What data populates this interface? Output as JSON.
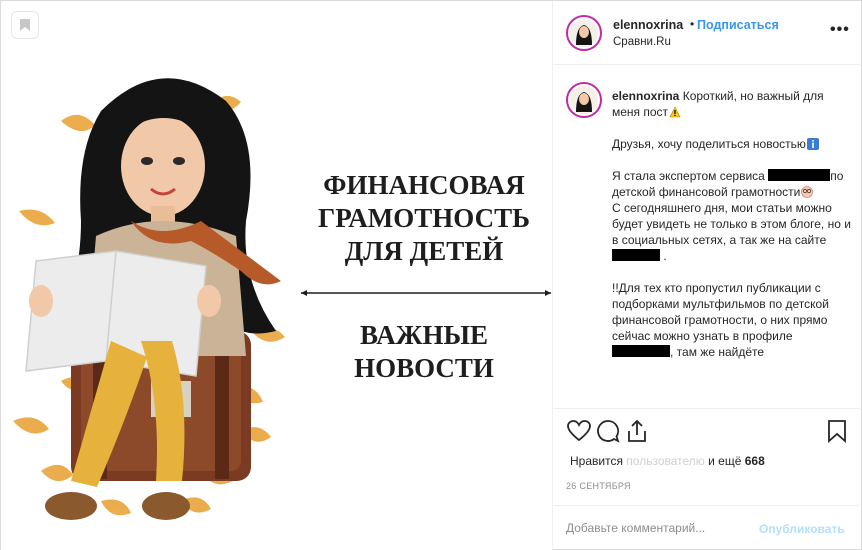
{
  "header": {
    "username": "elennoxrina",
    "separator": "•",
    "follow_label": "Подписаться",
    "location": "Сравни.Ru",
    "more_icon": "more-horizontal-icon"
  },
  "image": {
    "headline_1": [
      "ФИНАНСОВАЯ",
      "ГРАМОТНОСТЬ",
      "ДЛЯ ДЕТЕЙ"
    ],
    "headline_2": [
      "ВАЖНЫЕ",
      "НОВОСТИ"
    ],
    "bookmark_icon": "bookmark-filled-icon"
  },
  "caption": {
    "username": "elennoxrina",
    "p1": "Короткий, но важный для меня пост",
    "p2": "Друзья, хочу поделиться новостью",
    "p3a": "Я стала экспертом сервиса",
    "p3b": "по детской финансовой грамотности",
    "p3c": "С сегодняшнего дня, мои статьи можно будет увидеть не только в этом блоге, но и в социальных сетях, а так же на сайте",
    "p3d": ".",
    "p4a": "!!Для тех кто пропустил публикации с подборками мультфильмов по детской финансовой грамотности, о них прямо сейчас можно узнать в профиле",
    "p4b": ", там же найдёте"
  },
  "actions": {
    "like_icon": "heart-icon",
    "comment_icon": "comment-icon",
    "share_icon": "share-icon",
    "save_icon": "bookmark-icon"
  },
  "likes": {
    "prefix": "Нравится",
    "blurred": "пользователю",
    "and_more": "и ещё",
    "count": "668"
  },
  "date": "26 сентября",
  "add_comment": {
    "placeholder": "Добавьте комментарий...",
    "publish_label": "Опубликовать"
  },
  "colors": {
    "follow": "#3897f0",
    "publish_disabled": "#b2dffc",
    "avatar_ring": "#c32aa3"
  }
}
